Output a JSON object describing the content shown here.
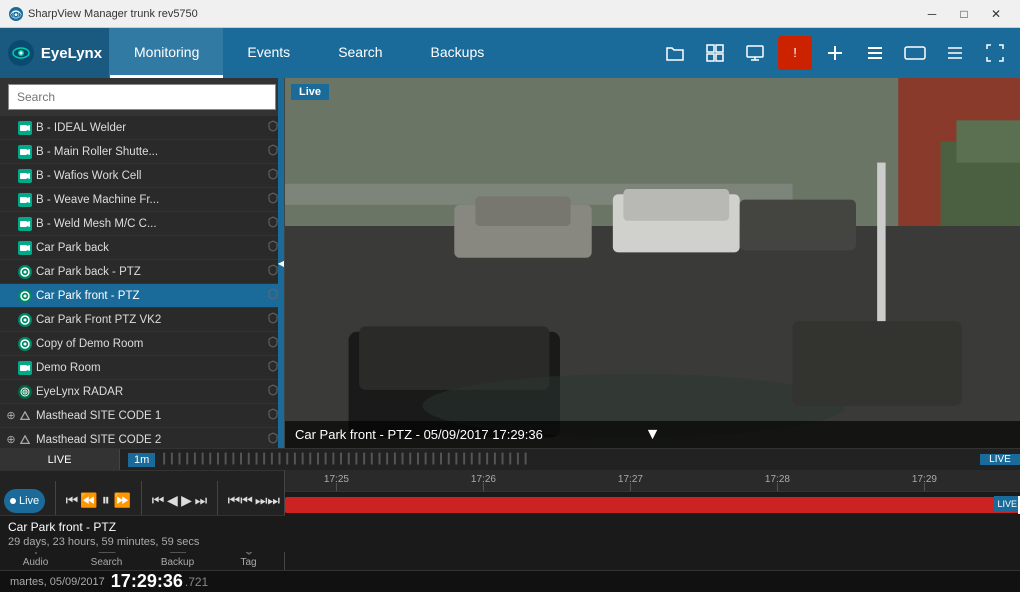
{
  "titlebar": {
    "title": "SharpView Manager trunk rev5750",
    "logo_icon": "🦁",
    "controls": [
      "─",
      "□",
      "✕"
    ]
  },
  "navbar": {
    "logo_text": "EyeLynx",
    "items": [
      {
        "label": "Monitoring",
        "active": true
      },
      {
        "label": "Events",
        "active": false
      },
      {
        "label": "Search",
        "active": false
      },
      {
        "label": "Backups",
        "active": false
      }
    ],
    "icons": [
      "folder",
      "grid",
      "monitor",
      "alert",
      "plus",
      "list",
      "tag",
      "menu",
      "expand"
    ]
  },
  "sidebar": {
    "search_placeholder": "Search",
    "cameras": [
      {
        "name": "B - IDEAL Welder",
        "type": "box",
        "indent": 0
      },
      {
        "name": "B - Main Roller Shutte...",
        "type": "box",
        "indent": 0
      },
      {
        "name": "B - Wafios Work Cell",
        "type": "box",
        "indent": 0
      },
      {
        "name": "B - Weave Machine Fr...",
        "type": "box",
        "indent": 0
      },
      {
        "name": "B - Weld Mesh M/C C...",
        "type": "box",
        "indent": 0
      },
      {
        "name": "Car Park back",
        "type": "box",
        "indent": 0
      },
      {
        "name": "Car Park back - PTZ",
        "type": "ptz",
        "indent": 0
      },
      {
        "name": "Car Park front - PTZ",
        "type": "ptz",
        "indent": 0,
        "active": true
      },
      {
        "name": "Car Park Front PTZ VK2",
        "type": "ptz",
        "indent": 0
      },
      {
        "name": "Copy of Demo Room",
        "type": "ptz",
        "indent": 0
      },
      {
        "name": "Demo Room",
        "type": "box",
        "indent": 0
      },
      {
        "name": "EyeLynx RADAR",
        "type": "radar",
        "indent": 0
      },
      {
        "name": "Masthead SITE CODE 1",
        "type": "site",
        "indent": 0,
        "expandable": true
      },
      {
        "name": "Masthead SITE CODE 2",
        "type": "site",
        "indent": 0,
        "expandable": true
      }
    ]
  },
  "video": {
    "live_badge": "Live",
    "caption": "Car Park front - PTZ - 05/09/2017 17:29:36"
  },
  "timeline": {
    "live_label": "LIVE",
    "zoom": "1m",
    "camera_name": "Car Park front - PTZ",
    "duration": "29 days, 23 hours, 59 minutes, 59 secs",
    "time_markers": [
      "17:25",
      "17:26",
      "17:27",
      "17:28",
      "17:29"
    ],
    "live_end": "LIVE"
  },
  "controls": {
    "live_btn": "Live",
    "buttons": {
      "skip_back": "⏮",
      "fast_back": "⏪",
      "pause": "⏸",
      "fast_fwd": "⏩",
      "prev_rec": "⏭",
      "next_rec": "⏭",
      "skip_prev": "⏮",
      "skip_next": "⏭"
    },
    "side_buttons": [
      {
        "icon": "🎤",
        "label": "Audio"
      },
      {
        "icon": "🔍",
        "label": "Search"
      },
      {
        "icon": "⬇",
        "label": "Backup"
      },
      {
        "icon": "📍",
        "label": "Tag"
      }
    ]
  },
  "datetime": {
    "date": "martes, 05/09/2017",
    "time": "17:29:36",
    "ms": ".721"
  }
}
